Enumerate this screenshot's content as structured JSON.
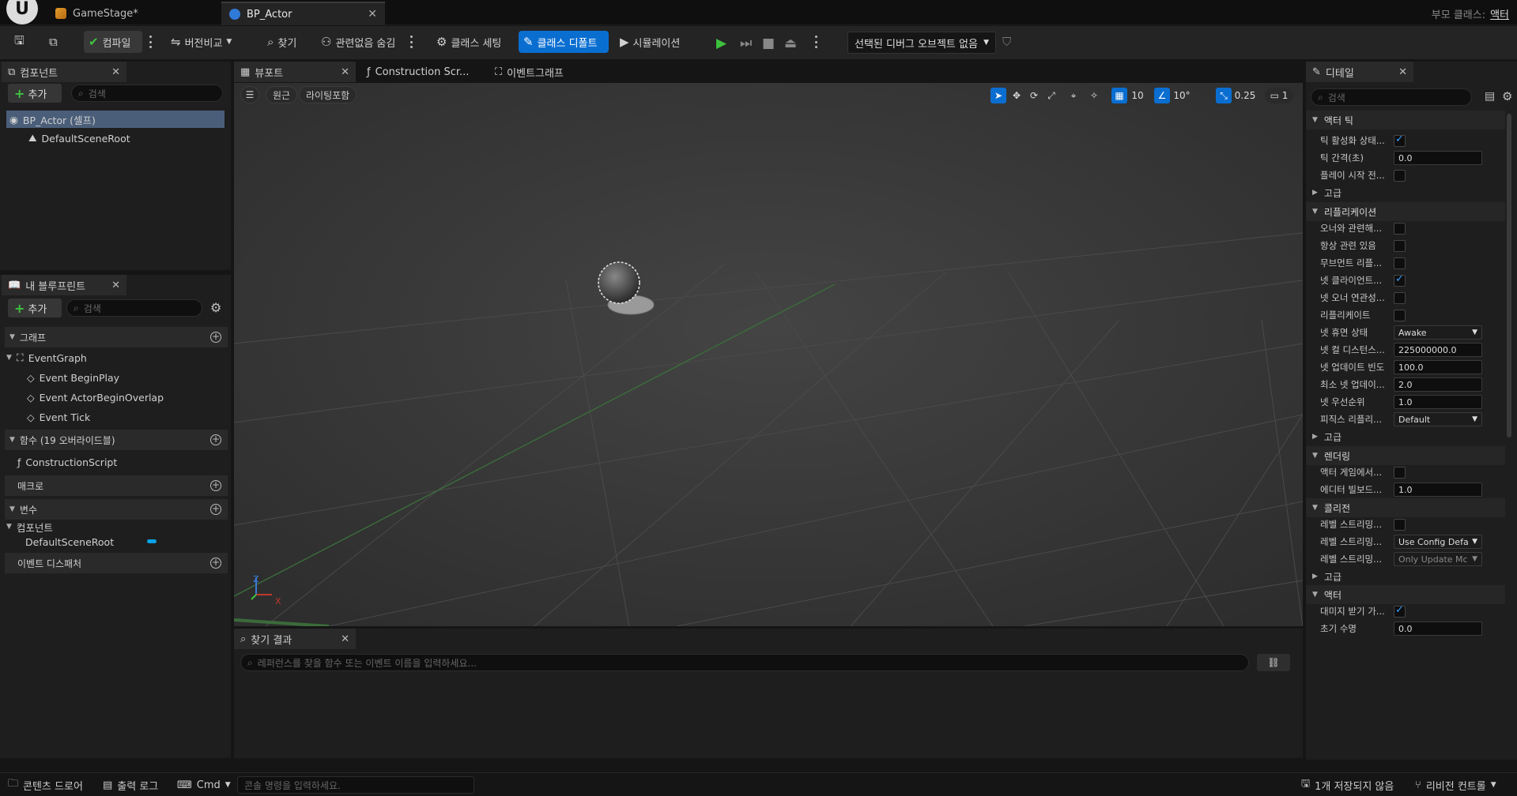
{
  "titlebar": {
    "tabs": [
      {
        "label": "GameStage*",
        "icon": "level-icon"
      },
      {
        "label": "BP_Actor",
        "icon": "blueprint-icon",
        "close": "✕"
      }
    ],
    "parent_class_label": "부모 클래스:",
    "parent_class_value": "액터"
  },
  "toolbar": {
    "compile": "컴파일",
    "diff": "버전비교",
    "find": "찾기",
    "hide_unrelated": "관련없음 숨김",
    "class_settings": "클래스 세팅",
    "class_defaults": "클래스 디폴트",
    "simulation": "시뮬레이션",
    "debug_object": "선택된 디버그 오브젝트 없음"
  },
  "components": {
    "tab": "컴포넌트",
    "add": "추가",
    "search_placeholder": "검색",
    "items": [
      "BP_Actor (셀프)",
      "DefaultSceneRoot"
    ]
  },
  "my_blueprint": {
    "tab": "내 블루프린트",
    "add": "추가",
    "search_placeholder": "검색",
    "graphs_header": "그래프",
    "event_graph": "EventGraph",
    "events": [
      "Event BeginPlay",
      "Event ActorBeginOverlap",
      "Event Tick"
    ],
    "functions_header": "함수 (19 오버라이드블)",
    "construction_script": "ConstructionScript",
    "macros_header": "매크로",
    "variables_header": "변수",
    "components_sub": "컴포넌트",
    "default_scene_root": "DefaultSceneRoot",
    "event_dispatchers": "이벤트 디스패처"
  },
  "editor_tabs": {
    "viewport": "뷰포트",
    "construction": "Construction Scr...",
    "event_graph": "이벤트그래프"
  },
  "viewport": {
    "perspective": "원근",
    "lit": "라이팅포함",
    "grid_snap": "10",
    "rot_snap": "10°",
    "scale_snap": "0.25",
    "camera_speed": "1",
    "axis_x": "X",
    "axis_z": "Z"
  },
  "find_results": {
    "tab": "찾기 결과",
    "placeholder": "레퍼런스를 찾을 함수 또는 이벤트 이름을 입력하세요..."
  },
  "details": {
    "tab": "디테일",
    "search_placeholder": "검색",
    "cat_actor_tick": "액터 틱",
    "tick_enabled": "틱 활성화 상태...",
    "tick_interval": "틱 간격(초)",
    "tick_interval_val": "0.0",
    "start_with_tick": "플레이 시작 전...",
    "advanced": "고급",
    "cat_replication": "리플리케이션",
    "owner_relevant": "오너와 관련해...",
    "always_relevant": "항상 관련 있음",
    "replicate_movement": "무브먼트 리플...",
    "net_load_client": "넷 클라이언트...",
    "net_use_owner": "넷 오너 연관성...",
    "replicates": "리플리케이트",
    "net_dormancy": "넷 휴면 상태",
    "net_dormancy_val": "Awake",
    "net_cull_distance": "넷 컬 디스턴스...",
    "net_cull_distance_val": "225000000.0",
    "net_update_freq": "넷 업데이트 빈도",
    "net_update_freq_val": "100.0",
    "min_net_update": "최소 넷 업데이...",
    "min_net_update_val": "2.0",
    "net_priority": "넷 우선순위",
    "net_priority_val": "1.0",
    "physics_rep": "피직스 리플리...",
    "physics_rep_val": "Default",
    "cat_rendering": "렌더링",
    "actor_hidden": "액터 게임에서...",
    "editor_billboard": "에디터 빌보드...",
    "editor_billboard_val": "1.0",
    "cat_collision": "콜리전",
    "level_stream_1": "레벨 스트리밍...",
    "level_stream_2": "레벨 스트리밍...",
    "level_stream_2_val": "Use Config Defa",
    "level_stream_3": "레벨 스트리밍...",
    "level_stream_3_val": "Only Update Mc",
    "cat_actor": "액터",
    "can_be_damaged": "대미지 받기 가...",
    "initial_life": "초기 수명",
    "initial_life_val": "0.0"
  },
  "statusbar": {
    "content_drawer": "콘텐츠 드로어",
    "output_log": "출력 로그",
    "cmd": "Cmd",
    "console_placeholder": "콘솔 명령을 입력하세요.",
    "unsaved": "1개 저장되지 않음",
    "revision_control": "리비전 컨트롤"
  },
  "colors": {
    "accent": "#0a6ed1",
    "play": "#3ec23e",
    "check": "#3aa0ff"
  }
}
